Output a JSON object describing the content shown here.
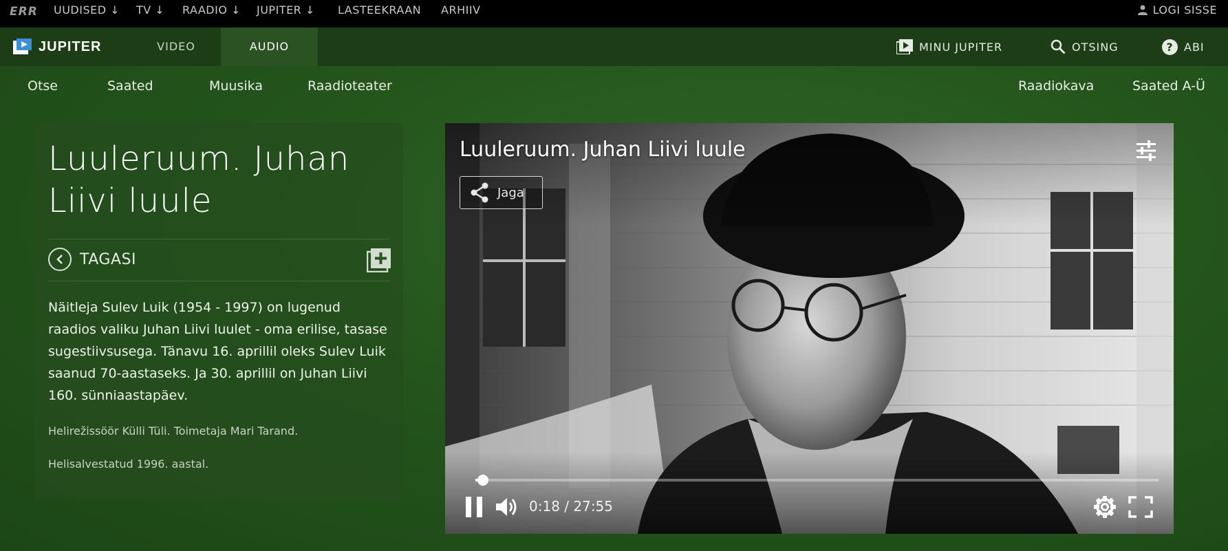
{
  "err_bar": {
    "logo": "ERR",
    "menu": [
      {
        "label": "UUDISED ↓"
      },
      {
        "label": "TV ↓"
      },
      {
        "label": "RAADIO ↓"
      },
      {
        "label": "JUPITER ↓"
      },
      {
        "label": "LASTEEKRAAN"
      },
      {
        "label": "ARHIIV"
      }
    ],
    "login_label": "LOGI SISSE"
  },
  "jupiter_bar": {
    "brand": "JUPITER",
    "tabs": [
      {
        "label": "VIDEO",
        "active": false
      },
      {
        "label": "AUDIO",
        "active": true
      }
    ],
    "right": [
      {
        "label": "MINU JUPITER",
        "icon": "play-box-icon"
      },
      {
        "label": "OTSING",
        "icon": "search-icon"
      },
      {
        "label": "ABI",
        "icon": "help-icon"
      }
    ]
  },
  "subnav": {
    "left": [
      {
        "label": "Otse"
      },
      {
        "label": "Saated"
      },
      {
        "label": "Muusika"
      },
      {
        "label": "Raadioteater"
      }
    ],
    "right": [
      {
        "label": "Raadiokava"
      },
      {
        "label": "Saated A-Ü"
      }
    ]
  },
  "program": {
    "title": "Luuleruum. Juhan Liivi luule",
    "back_label": "TAGASI",
    "description": "Näitleja Sulev Luik (1954 - 1997) on lugenud raadios valiku Juhan Liivi luulet - oma erilise, tasase sugestiivsusega. Tänavu 16. aprillil oleks Sulev Luik saanud 70-aastaseks. Ja 30. aprillil on Juhan Liivi 160. sünniaastapäev.",
    "credits": [
      "Helirežissöör Külli Tüli. Toimetaja Mari Tarand.",
      "Helisalvestatud 1996. aastal."
    ]
  },
  "player": {
    "title": "Luuleruum. Juhan Liivi luule",
    "share_label": "Jaga",
    "time_display": "0:18 / 27:55",
    "progress_fraction": 0.011,
    "state": "playing"
  },
  "colors": {
    "page_bg": "#24551c",
    "top_bar": "#000000",
    "jupiter_bar": "#1d3d17",
    "active_tab": "#2a5222",
    "panel": "#264c1f"
  }
}
